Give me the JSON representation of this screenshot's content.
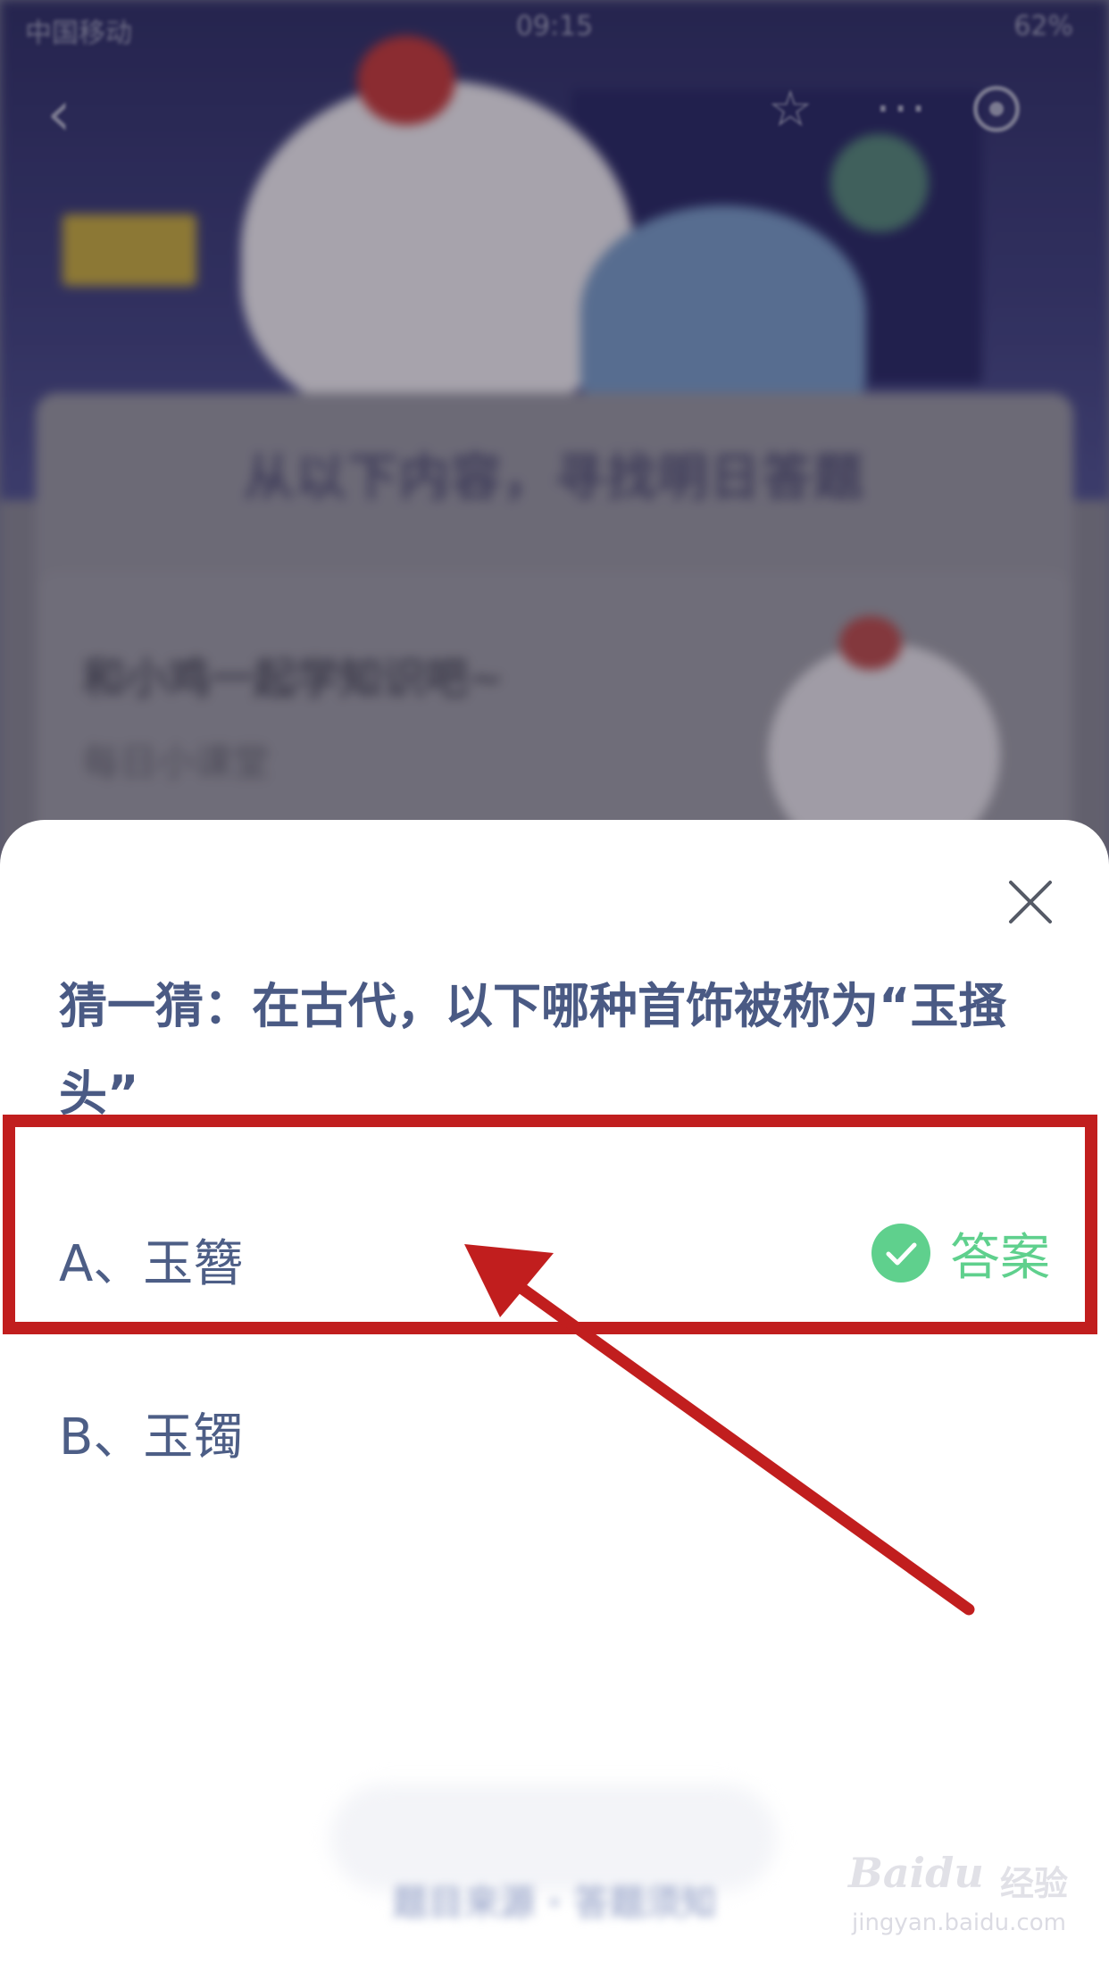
{
  "status_bar": {
    "carrier": "中国移动",
    "time": "09:15",
    "battery": "62%"
  },
  "background": {
    "heading": "从以下内容，寻找明日答题",
    "card_title": "和小鸡一起学知识吧~",
    "card_subtitle": "每日小课堂"
  },
  "quiz": {
    "question": "猜一猜：在古代，以下哪种首饰被称为“玉搔头”",
    "options": [
      {
        "label": "A、玉簪",
        "is_answer": true
      },
      {
        "label": "B、玉镯",
        "is_answer": false
      }
    ],
    "answer_label": "答案",
    "answer_color": "#5fd08d",
    "footer_text": "题目来源 · 答题须知"
  },
  "annotation": {
    "color": "#c11e1e"
  },
  "watermark": {
    "brand": "Baidu",
    "brand_cn": "经验",
    "url": "jingyan.baidu.com"
  }
}
